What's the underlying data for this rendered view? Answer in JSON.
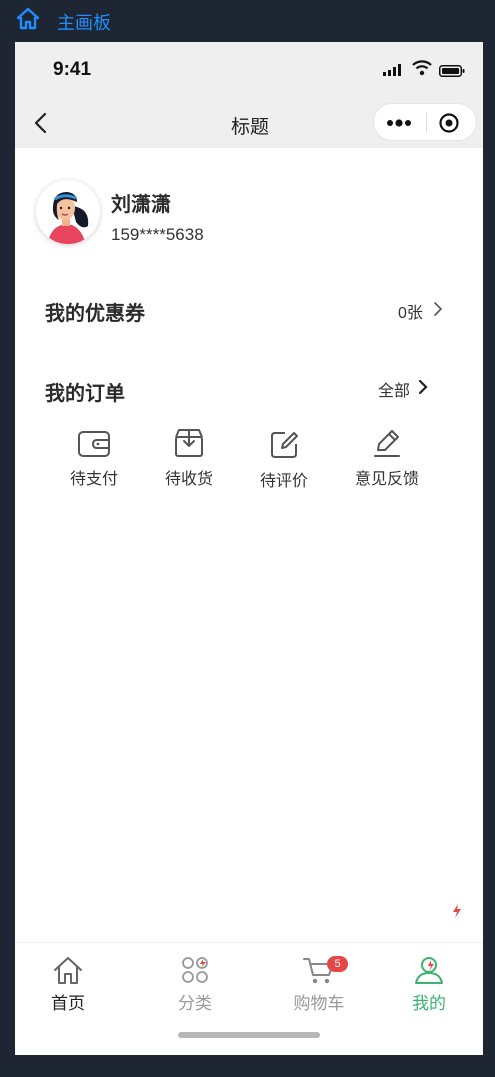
{
  "topbar": {
    "title": "主画板"
  },
  "status": {
    "time": "9:41"
  },
  "nav": {
    "title": "标题"
  },
  "user": {
    "name": "刘潇潇",
    "phone": "159****5638"
  },
  "coupon": {
    "title": "我的优惠券",
    "count": "0张"
  },
  "orders": {
    "title": "我的订单",
    "all": "全部",
    "items": [
      {
        "label": "待支付",
        "icon": "wallet-icon"
      },
      {
        "label": "待收货",
        "icon": "box-icon"
      },
      {
        "label": "待评价",
        "icon": "edit-square-icon"
      },
      {
        "label": "意见反馈",
        "icon": "pencil-icon"
      }
    ]
  },
  "tabs": [
    {
      "label": "首页",
      "icon": "home-icon",
      "color": "#222222"
    },
    {
      "label": "分类",
      "icon": "category-icon",
      "color": "#9a9a9a"
    },
    {
      "label": "购物车",
      "icon": "cart-icon",
      "color": "#9a9a9a",
      "badge": "5"
    },
    {
      "label": "我的",
      "icon": "user-icon",
      "color": "#3cb371"
    }
  ],
  "colors": {
    "accent": "#3cb371",
    "badge": "#e54646",
    "topbar_text": "#1f8fff"
  }
}
